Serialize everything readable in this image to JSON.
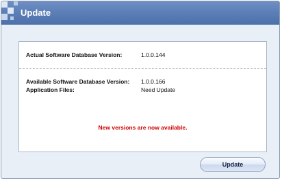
{
  "window": {
    "title": "Update"
  },
  "info": {
    "actual_label": "Actual Software Database Version:",
    "actual_value": "1.0.0.144",
    "available_label": "Available Software Database Version:",
    "available_value": "1.0.0.166",
    "app_files_label": "Application Files:",
    "app_files_value": "Need Update",
    "notice": "New versions are now available."
  },
  "footer": {
    "update_button": "Update"
  },
  "colors": {
    "title_bar": "#5d7fb8",
    "notice_text": "#d10000",
    "background": "#e9eff7"
  },
  "icons": {
    "title_logo": "checkered-squares-icon"
  }
}
